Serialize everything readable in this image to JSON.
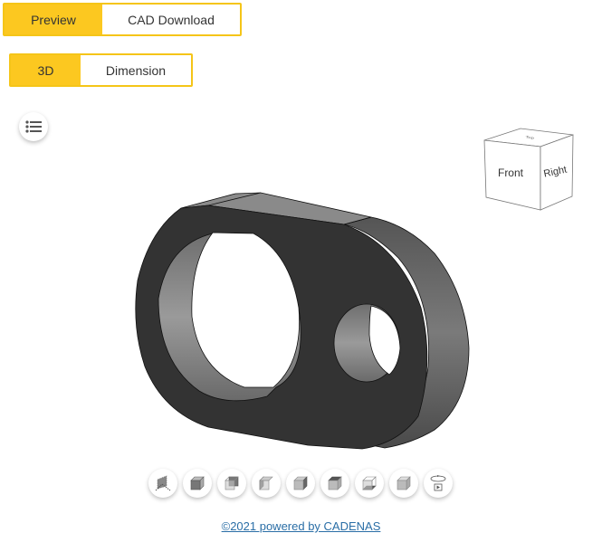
{
  "main_tabs": [
    {
      "label": "Preview",
      "active": true
    },
    {
      "label": "CAD Download",
      "active": false
    }
  ],
  "view_tabs": [
    {
      "label": "3D",
      "active": true
    },
    {
      "label": "Dimension",
      "active": false
    }
  ],
  "menu_button": {
    "icon": "list-icon"
  },
  "viewcube": {
    "faces": {
      "front": "Front",
      "right": "Right",
      "top": "Top"
    }
  },
  "model": {
    "description": "oval plate with large and small through-holes",
    "color": "#333333",
    "wall_color": "#7a7a7a"
  },
  "view_toolbar": {
    "buttons": [
      {
        "name": "isometric-view",
        "icon": "isometric-icon"
      },
      {
        "name": "front-view",
        "icon": "cube-front-icon"
      },
      {
        "name": "back-view",
        "icon": "cube-back-icon"
      },
      {
        "name": "left-view",
        "icon": "cube-left-icon"
      },
      {
        "name": "right-view",
        "icon": "cube-right-icon"
      },
      {
        "name": "top-view",
        "icon": "cube-top-icon"
      },
      {
        "name": "bottom-view",
        "icon": "cube-bottom-icon"
      },
      {
        "name": "reset-view",
        "icon": "cube-default-icon"
      },
      {
        "name": "rotate-animation",
        "icon": "rotate-play-icon"
      }
    ]
  },
  "footer": {
    "link_text": "©2021 powered by CADENAS"
  },
  "colors": {
    "accent": "#fcc820",
    "link": "#2a6ea6"
  }
}
